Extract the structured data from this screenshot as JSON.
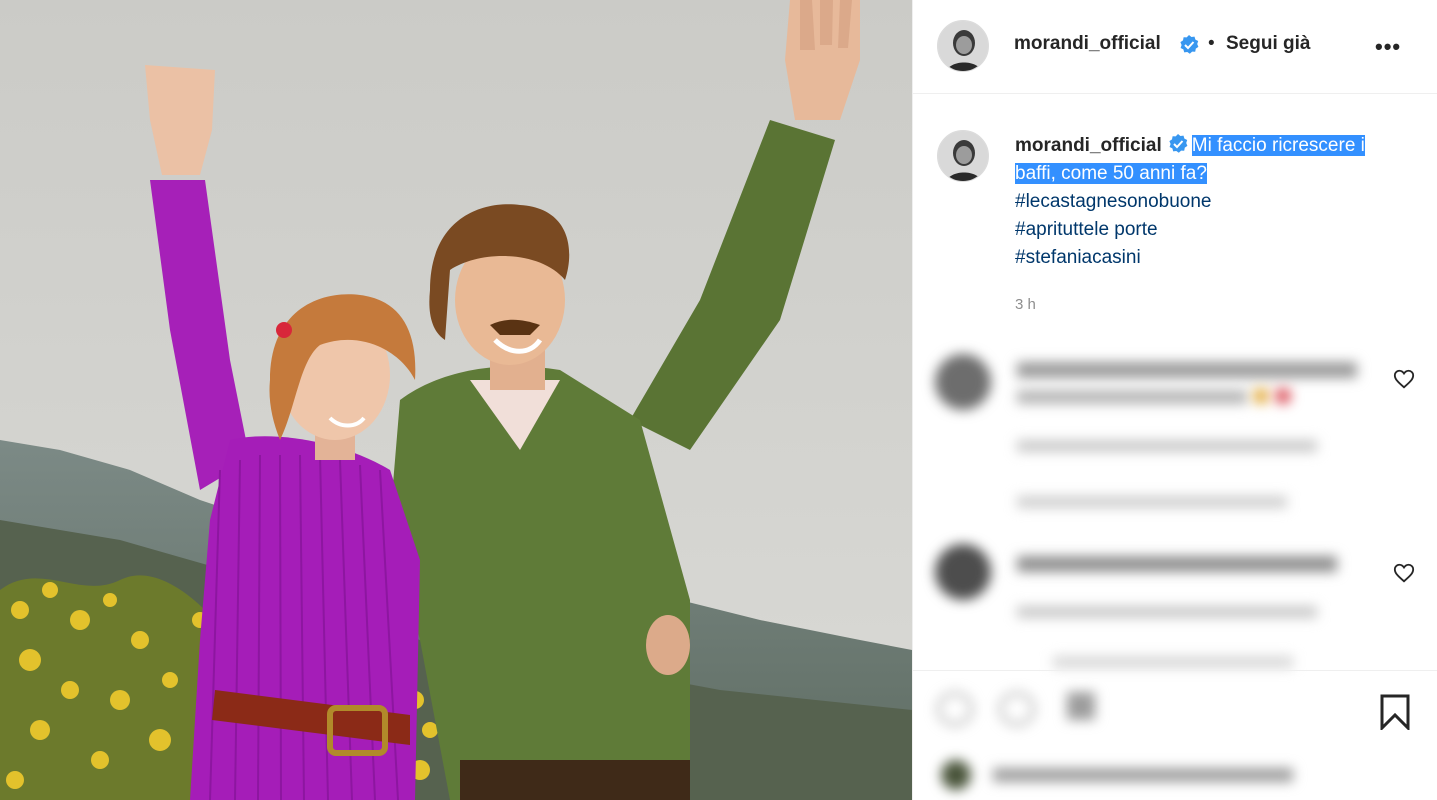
{
  "post": {
    "username": "morandi_official",
    "separator": "•",
    "follow_label": "Segui già",
    "more_label": "•••"
  },
  "caption": {
    "username": "morandi_official",
    "text_line1": "Mi faccio ricrescere i",
    "text_line2": "baffi, come 50 anni fa?",
    "hashtags": [
      "#lecastagnesonobuone",
      "#aprituttele porte",
      "#stefaniacasini"
    ],
    "timestamp": "3 h"
  },
  "icons": {
    "verified": "verified-badge-icon",
    "like": "heart-icon",
    "save": "bookmark-icon",
    "more": "more-options-icon"
  },
  "colors": {
    "verified_blue": "#3897f0",
    "hashtag": "#00376b",
    "selection": "#3390ff",
    "muted": "#8e8e8e"
  }
}
